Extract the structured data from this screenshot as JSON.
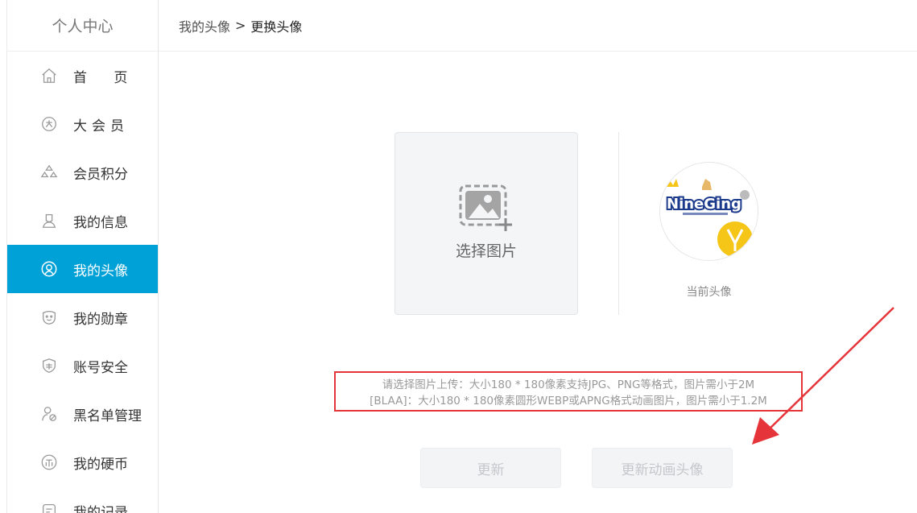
{
  "sidebar": {
    "title": "个人中心",
    "items": [
      {
        "label": "首    页",
        "icon": "home-icon"
      },
      {
        "label": "大会员",
        "icon": "vip-icon"
      },
      {
        "label": "会员积分",
        "icon": "points-icon"
      },
      {
        "label": "我的信息",
        "icon": "user-info-icon"
      },
      {
        "label": "我的头像",
        "icon": "avatar-icon",
        "active": true
      },
      {
        "label": "我的勋章",
        "icon": "medal-icon"
      },
      {
        "label": "账号安全",
        "icon": "shield-icon"
      },
      {
        "label": "黑名单管理",
        "icon": "blacklist-icon"
      },
      {
        "label": "我的硬币",
        "icon": "coin-icon"
      },
      {
        "label": "我的记录",
        "icon": "record-icon"
      }
    ]
  },
  "breadcrumb": {
    "parent": "我的头像",
    "separator": ">",
    "current": "更换头像"
  },
  "upload": {
    "label": "选择图片"
  },
  "avatar": {
    "caption": "当前头像",
    "logo_text": "NineGing"
  },
  "notice": {
    "line1": "请选择图片上传：大小180 * 180像素支持JPG、PNG等格式，图片需小于2M",
    "line2": "[BLAA]：大小180 * 180像素圆形WEBP或APNG格式动画图片，图片需小于1.2M"
  },
  "buttons": {
    "update": "更新",
    "update_anim": "更新动画头像"
  },
  "colors": {
    "accent": "#00a1d6",
    "annotation": "#e5353b"
  }
}
